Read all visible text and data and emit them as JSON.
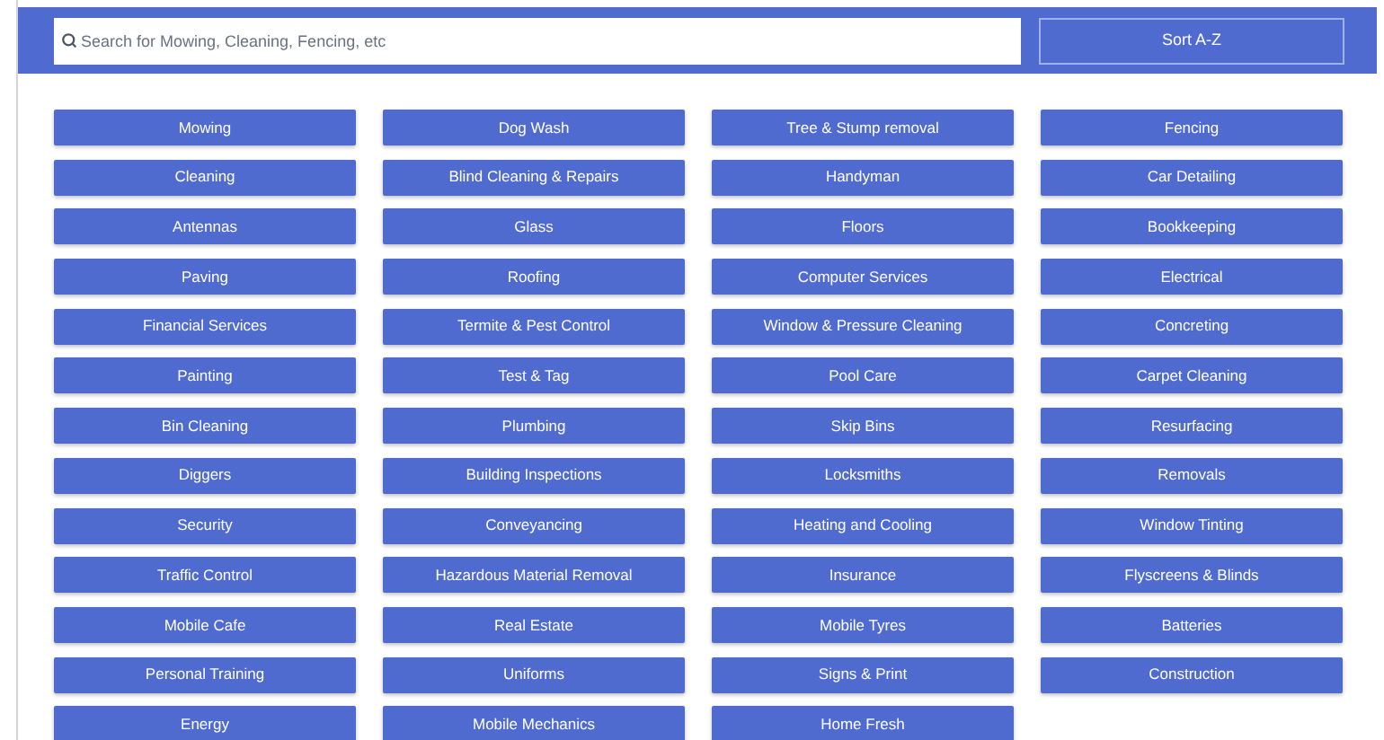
{
  "search": {
    "placeholder": "Search for Mowing, Cleaning, Fencing, etc"
  },
  "sort_button": "Sort A-Z",
  "categories": [
    "Mowing",
    "Dog Wash",
    "Tree & Stump removal",
    "Fencing",
    "Cleaning",
    "Blind Cleaning & Repairs",
    "Handyman",
    "Car Detailing",
    "Antennas",
    "Glass",
    "Floors",
    "Bookkeeping",
    "Paving",
    "Roofing",
    "Computer Services",
    "Electrical",
    "Financial Services",
    "Termite & Pest Control",
    "Window & Pressure Cleaning",
    "Concreting",
    "Painting",
    "Test & Tag",
    "Pool Care",
    "Carpet Cleaning",
    "Bin Cleaning",
    "Plumbing",
    "Skip Bins",
    "Resurfacing",
    "Diggers",
    "Building Inspections",
    "Locksmiths",
    "Removals",
    "Security",
    "Conveyancing",
    "Heating and Cooling",
    "Window Tinting",
    "Traffic Control",
    "Hazardous Material Removal",
    "Insurance",
    "Flyscreens & Blinds",
    "Mobile Cafe",
    "Real Estate",
    "Mobile Tyres",
    "Batteries",
    "Personal Training",
    "Uniforms",
    "Signs & Print",
    "Construction",
    "Energy",
    "Mobile Mechanics",
    "Home Fresh"
  ]
}
